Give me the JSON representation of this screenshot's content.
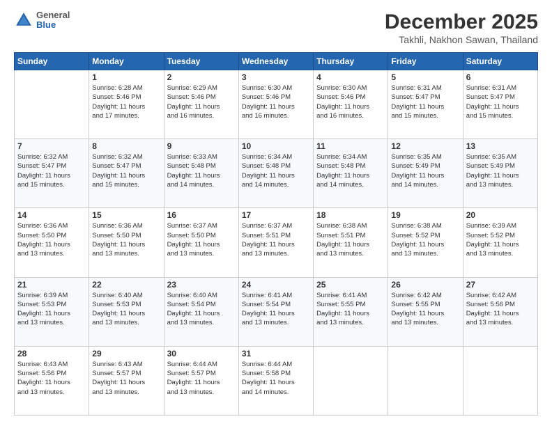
{
  "header": {
    "logo": {
      "general": "General",
      "blue": "Blue"
    },
    "title": "December 2025",
    "location": "Takhli, Nakhon Sawan, Thailand"
  },
  "days_of_week": [
    "Sunday",
    "Monday",
    "Tuesday",
    "Wednesday",
    "Thursday",
    "Friday",
    "Saturday"
  ],
  "weeks": [
    [
      {
        "day": "",
        "info": ""
      },
      {
        "day": "1",
        "info": "Sunrise: 6:28 AM\nSunset: 5:46 PM\nDaylight: 11 hours\nand 17 minutes."
      },
      {
        "day": "2",
        "info": "Sunrise: 6:29 AM\nSunset: 5:46 PM\nDaylight: 11 hours\nand 16 minutes."
      },
      {
        "day": "3",
        "info": "Sunrise: 6:30 AM\nSunset: 5:46 PM\nDaylight: 11 hours\nand 16 minutes."
      },
      {
        "day": "4",
        "info": "Sunrise: 6:30 AM\nSunset: 5:46 PM\nDaylight: 11 hours\nand 16 minutes."
      },
      {
        "day": "5",
        "info": "Sunrise: 6:31 AM\nSunset: 5:47 PM\nDaylight: 11 hours\nand 15 minutes."
      },
      {
        "day": "6",
        "info": "Sunrise: 6:31 AM\nSunset: 5:47 PM\nDaylight: 11 hours\nand 15 minutes."
      }
    ],
    [
      {
        "day": "7",
        "info": ""
      },
      {
        "day": "8",
        "info": "Sunrise: 6:32 AM\nSunset: 5:47 PM\nDaylight: 11 hours\nand 15 minutes."
      },
      {
        "day": "9",
        "info": "Sunrise: 6:33 AM\nSunset: 5:48 PM\nDaylight: 11 hours\nand 14 minutes."
      },
      {
        "day": "10",
        "info": "Sunrise: 6:34 AM\nSunset: 5:48 PM\nDaylight: 11 hours\nand 14 minutes."
      },
      {
        "day": "11",
        "info": "Sunrise: 6:34 AM\nSunset: 5:48 PM\nDaylight: 11 hours\nand 14 minutes."
      },
      {
        "day": "12",
        "info": "Sunrise: 6:35 AM\nSunset: 5:49 PM\nDaylight: 11 hours\nand 14 minutes."
      },
      {
        "day": "13",
        "info": "Sunrise: 6:35 AM\nSunset: 5:49 PM\nDaylight: 11 hours\nand 13 minutes."
      }
    ],
    [
      {
        "day": "14",
        "info": ""
      },
      {
        "day": "15",
        "info": "Sunrise: 6:36 AM\nSunset: 5:50 PM\nDaylight: 11 hours\nand 13 minutes."
      },
      {
        "day": "16",
        "info": "Sunrise: 6:37 AM\nSunset: 5:50 PM\nDaylight: 11 hours\nand 13 minutes."
      },
      {
        "day": "17",
        "info": "Sunrise: 6:37 AM\nSunset: 5:51 PM\nDaylight: 11 hours\nand 13 minutes."
      },
      {
        "day": "18",
        "info": "Sunrise: 6:38 AM\nSunset: 5:51 PM\nDaylight: 11 hours\nand 13 minutes."
      },
      {
        "day": "19",
        "info": "Sunrise: 6:38 AM\nSunset: 5:52 PM\nDaylight: 11 hours\nand 13 minutes."
      },
      {
        "day": "20",
        "info": "Sunrise: 6:39 AM\nSunset: 5:52 PM\nDaylight: 11 hours\nand 13 minutes."
      }
    ],
    [
      {
        "day": "21",
        "info": ""
      },
      {
        "day": "22",
        "info": "Sunrise: 6:40 AM\nSunset: 5:53 PM\nDaylight: 11 hours\nand 13 minutes."
      },
      {
        "day": "23",
        "info": "Sunrise: 6:40 AM\nSunset: 5:54 PM\nDaylight: 11 hours\nand 13 minutes."
      },
      {
        "day": "24",
        "info": "Sunrise: 6:41 AM\nSunset: 5:54 PM\nDaylight: 11 hours\nand 13 minutes."
      },
      {
        "day": "25",
        "info": "Sunrise: 6:41 AM\nSunset: 5:55 PM\nDaylight: 11 hours\nand 13 minutes."
      },
      {
        "day": "26",
        "info": "Sunrise: 6:42 AM\nSunset: 5:55 PM\nDaylight: 11 hours\nand 13 minutes."
      },
      {
        "day": "27",
        "info": "Sunrise: 6:42 AM\nSunset: 5:56 PM\nDaylight: 11 hours\nand 13 minutes."
      }
    ],
    [
      {
        "day": "28",
        "info": "Sunrise: 6:43 AM\nSunset: 5:56 PM\nDaylight: 11 hours\nand 13 minutes."
      },
      {
        "day": "29",
        "info": "Sunrise: 6:43 AM\nSunset: 5:57 PM\nDaylight: 11 hours\nand 13 minutes."
      },
      {
        "day": "30",
        "info": "Sunrise: 6:44 AM\nSunset: 5:57 PM\nDaylight: 11 hours\nand 13 minutes."
      },
      {
        "day": "31",
        "info": "Sunrise: 6:44 AM\nSunset: 5:58 PM\nDaylight: 11 hours\nand 14 minutes."
      },
      {
        "day": "",
        "info": ""
      },
      {
        "day": "",
        "info": ""
      },
      {
        "day": "",
        "info": ""
      }
    ]
  ],
  "week7_sunday": {
    "info": "Sunrise: 6:32 AM\nSunset: 5:47 PM\nDaylight: 11 hours\nand 15 minutes."
  },
  "week14_sunday": {
    "info": "Sunrise: 6:36 AM\nSunset: 5:50 PM\nDaylight: 11 hours\nand 13 minutes."
  },
  "week21_sunday": {
    "info": "Sunrise: 6:39 AM\nSunset: 5:53 PM\nDaylight: 11 hours\nand 13 minutes."
  }
}
